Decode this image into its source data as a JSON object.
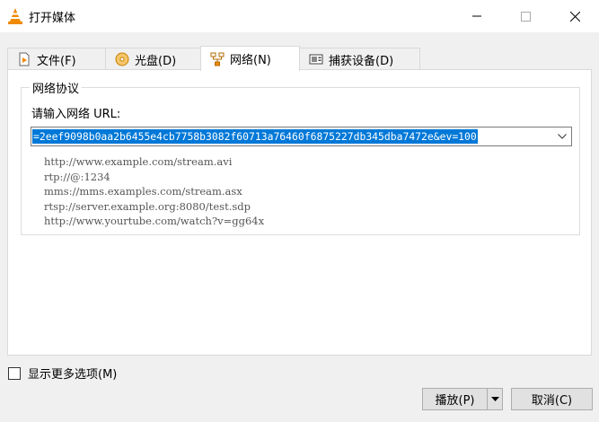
{
  "window": {
    "title": "打开媒体"
  },
  "tabs": [
    {
      "label": "文件(F)",
      "icon": "file-play-icon"
    },
    {
      "label": "光盘(D)",
      "icon": "disc-icon"
    },
    {
      "label": "网络(N)",
      "icon": "network-icon",
      "active": true
    },
    {
      "label": "捕获设备(D)",
      "icon": "capture-device-icon"
    }
  ],
  "network": {
    "group_title": "网络协议",
    "url_label": "请输入网络 URL:",
    "url_value": "=2eef9098b0aa2b6455e4cb7758b3082f60713a76460f6875227db345dba7472e&ev=100",
    "examples": [
      "http://www.example.com/stream.avi",
      "rtp://@:1234",
      "mms://mms.examples.com/stream.asx",
      "rtsp://server.example.org:8080/test.sdp",
      "http://www.yourtube.com/watch?v=gg64x"
    ]
  },
  "footer": {
    "show_more_label": "显示更多选项(M)",
    "play_label": "播放(P)",
    "cancel_label": "取消(C)"
  },
  "colors": {
    "selection": "#0078d7",
    "vlc_orange": "#f08a00"
  }
}
